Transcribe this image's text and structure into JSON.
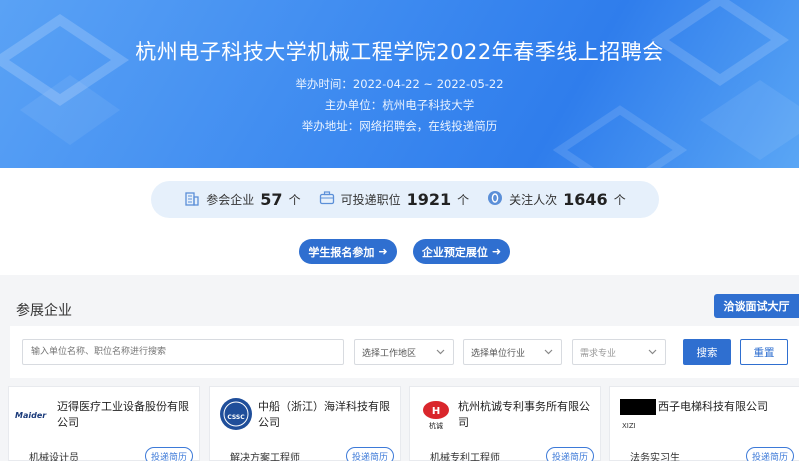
{
  "hero": {
    "title": "杭州电子科技大学机械工程学院2022年春季线上招聘会",
    "time": "举办时间：2022-04-22 ~ 2022-05-22",
    "organizer": "主办单位：杭州电子科技大学",
    "location": "举办地址：网络招聘会，在线投递简历"
  },
  "stats": [
    {
      "label": "参会企业",
      "value": "57",
      "unit": "个",
      "icon": "building-icon"
    },
    {
      "label": "可投递职位",
      "value": "1921",
      "unit": "个",
      "icon": "briefcase-icon"
    },
    {
      "label": "关注人次",
      "value": "1646",
      "unit": "个",
      "icon": "eye-icon"
    }
  ],
  "actions": {
    "student": "学生报名参加",
    "company": "企业预定展位"
  },
  "section": {
    "title": "参展企业",
    "hall_button": "洽谈面试大厅"
  },
  "filters": {
    "search_placeholder": "输入单位名称、职位名称进行搜索",
    "region": "选择工作地区",
    "industry": "选择单位行业",
    "major": "需求专业",
    "search_button": "搜索",
    "reset_button": "重置"
  },
  "companies": [
    {
      "name": "迈得医疗工业设备股份有限公司",
      "logo_text": "Maider",
      "job": "机械设计员",
      "apply": "投递简历"
    },
    {
      "name": "中船（浙江）海洋科技有限公司",
      "logo_text": "CSSC",
      "job": "解决方案工程师",
      "apply": "投递简历"
    },
    {
      "name": "杭州杭诚专利事务所有限公司",
      "logo_text": "杭诚",
      "job": "机械专利工程师",
      "apply": "投递简历"
    },
    {
      "name": "西子电梯科技有限公司",
      "logo_text": "XIZI",
      "job": "法务实习生",
      "apply": "投递简历"
    }
  ],
  "colors": {
    "primary": "#2f6fd0",
    "hero_start": "#5aa2f5",
    "hero_end": "#2f7dec",
    "stats_bg": "#e6f0fb"
  }
}
